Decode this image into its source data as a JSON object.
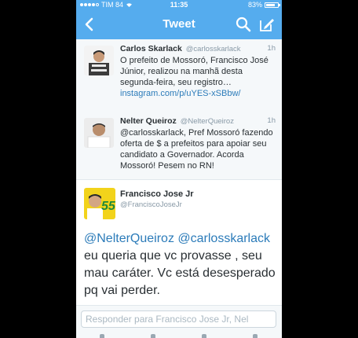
{
  "status_bar": {
    "carrier": "TIM 84",
    "time": "11:35",
    "battery": "83%",
    "battery_level": 0.83,
    "signal_bars": 4
  },
  "nav": {
    "title": "Tweet",
    "back_icon": "chevron-left-icon",
    "search_icon": "search-icon",
    "compose_icon": "compose-icon"
  },
  "tweets": [
    {
      "name": "Carlos Skarlack",
      "handle": "@carlosskarlack",
      "time": "1h",
      "text": "O prefeito de Mossoró, Francisco José Júnior, realizou na manhã desta segunda-feira, seu registro…",
      "link": "instagram.com/p/uYES-xSBbw/"
    },
    {
      "name": "Nelter Queiroz",
      "handle": "@NelterQueiroz",
      "time": "1h",
      "text": "@carlosskarlack, Pref Mossoró fazendo oferta de $ a prefeitos para apoiar seu candidato a Governador. Acorda Mossoró! Pesem no RN!"
    }
  ],
  "main_tweet": {
    "name": "Francisco Jose Jr",
    "handle": "@FranciscoJoseJr",
    "avatar_badge": "55",
    "mention1": "@NelterQueiroz",
    "mention2": "@carlosskarlack",
    "text": "eu queria que vc provasse , seu mau caráter. Vc está desesperado pq vai perder."
  },
  "reply": {
    "placeholder": "Responder para Francisco Jose Jr, Nel"
  },
  "colors": {
    "brand": "#55acee",
    "link": "#2b7bb9",
    "badge_yellow": "#f2d31b",
    "badge_green": "#1f8a3a"
  }
}
